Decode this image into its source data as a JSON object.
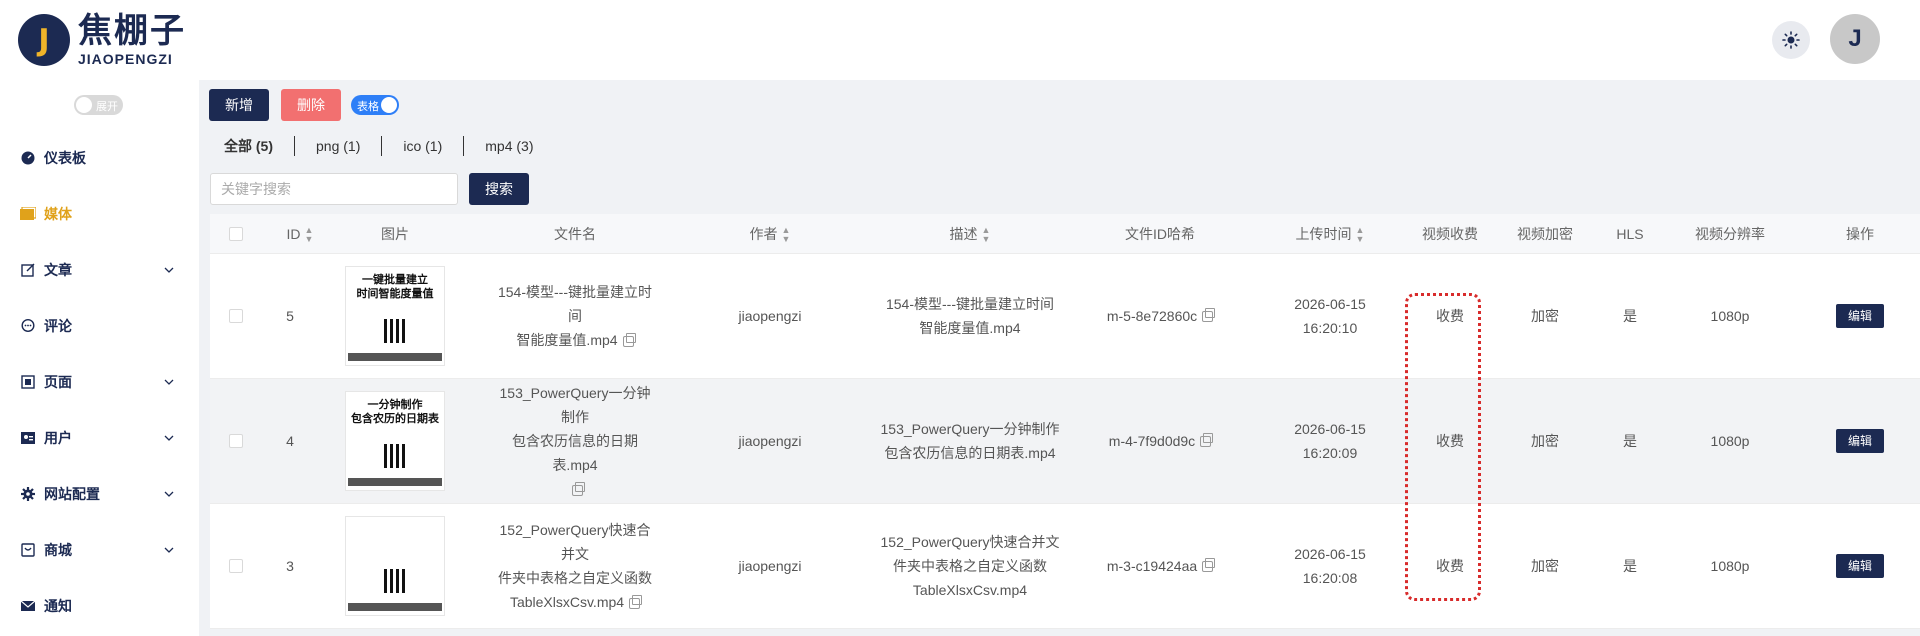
{
  "brand": {
    "badge": "J",
    "name_cn": "焦棚子",
    "name_en": "JIAOPENGZI"
  },
  "header": {
    "avatar_letter": "J"
  },
  "sidebar": {
    "toggle_label": "展开",
    "items": [
      {
        "label": "仪表板",
        "icon": "dashboard-icon",
        "has_children": false
      },
      {
        "label": "媒体",
        "icon": "media-icon",
        "has_children": false,
        "active": true
      },
      {
        "label": "文章",
        "icon": "edit-icon",
        "has_children": true
      },
      {
        "label": "评论",
        "icon": "comment-icon",
        "has_children": false
      },
      {
        "label": "页面",
        "icon": "page-icon",
        "has_children": true
      },
      {
        "label": "用户",
        "icon": "user-icon",
        "has_children": true
      },
      {
        "label": "网站配置",
        "icon": "gear-icon",
        "has_children": true
      },
      {
        "label": "商城",
        "icon": "shop-icon",
        "has_children": true
      },
      {
        "label": "通知",
        "icon": "mail-icon",
        "has_children": false
      }
    ]
  },
  "toolbar": {
    "new_label": "新增",
    "delete_label": "删除",
    "table_toggle_label": "表格"
  },
  "filters": [
    {
      "label": "全部 (5)",
      "active": true
    },
    {
      "label": "png (1)"
    },
    {
      "label": "ico (1)"
    },
    {
      "label": "mp4 (3)"
    }
  ],
  "search": {
    "placeholder": "关键字搜索",
    "button_label": "搜索"
  },
  "table": {
    "columns": [
      "ID",
      "图片",
      "文件名",
      "作者",
      "描述",
      "文件ID哈希",
      "上传时间",
      "视频收费",
      "视频加密",
      "HLS",
      "视频分辨率",
      "操作"
    ],
    "rows": [
      {
        "id": "5",
        "thumb_title_line1": "一键批量建立",
        "thumb_title_line2": "时间智能度量值",
        "filename_line1": "154-模型---键批量建立时间",
        "filename_line2": "智能度量值.mp4",
        "author": "jiaopengzi",
        "desc_line1": "154-模型---键批量建立时间",
        "desc_line2": "智能度量值.mp4",
        "hash": "m-5-8e72860c",
        "upload_date": "2026-06-15",
        "upload_time": "16:20:10",
        "fee": "收费",
        "encrypt": "加密",
        "hls": "是",
        "resolution": "1080p",
        "action": "编辑"
      },
      {
        "id": "4",
        "thumb_title_line1": "一分钟制作",
        "thumb_title_line2": "包含农历的日期表",
        "filename_line1": "153_PowerQuery一分钟制作",
        "filename_line2": "包含农历信息的日期表.mp4",
        "author": "jiaopengzi",
        "desc_line1": "153_PowerQuery一分钟制作",
        "desc_line2": "包含农历信息的日期表.mp4",
        "hash": "m-4-7f9d0d9c",
        "upload_date": "2026-06-15",
        "upload_time": "16:20:09",
        "fee": "收费",
        "encrypt": "加密",
        "hls": "是",
        "resolution": "1080p",
        "action": "编辑"
      },
      {
        "id": "3",
        "thumb_title_line1": "",
        "thumb_title_line2": "",
        "filename_line1": "152_PowerQuery快速合并文",
        "filename_line2": "件夹中表格之自定义函数",
        "filename_line3": "TableXlsxCsv.mp4",
        "author": "jiaopengzi",
        "desc_line1": "152_PowerQuery快速合并文",
        "desc_line2": "件夹中表格之自定义函数",
        "desc_line3": "TableXlsxCsv.mp4",
        "hash": "m-3-c19424aa",
        "upload_date": "2026-06-15",
        "upload_time": "16:20:08",
        "fee": "收费",
        "encrypt": "加密",
        "hls": "是",
        "resolution": "1080p",
        "action": "编辑"
      }
    ]
  },
  "colors": {
    "primary": "#1c2a52",
    "danger": "#f27070",
    "accent": "#e0a21b",
    "toggle": "#2e7ff7",
    "highlight": "#d82b2b"
  }
}
